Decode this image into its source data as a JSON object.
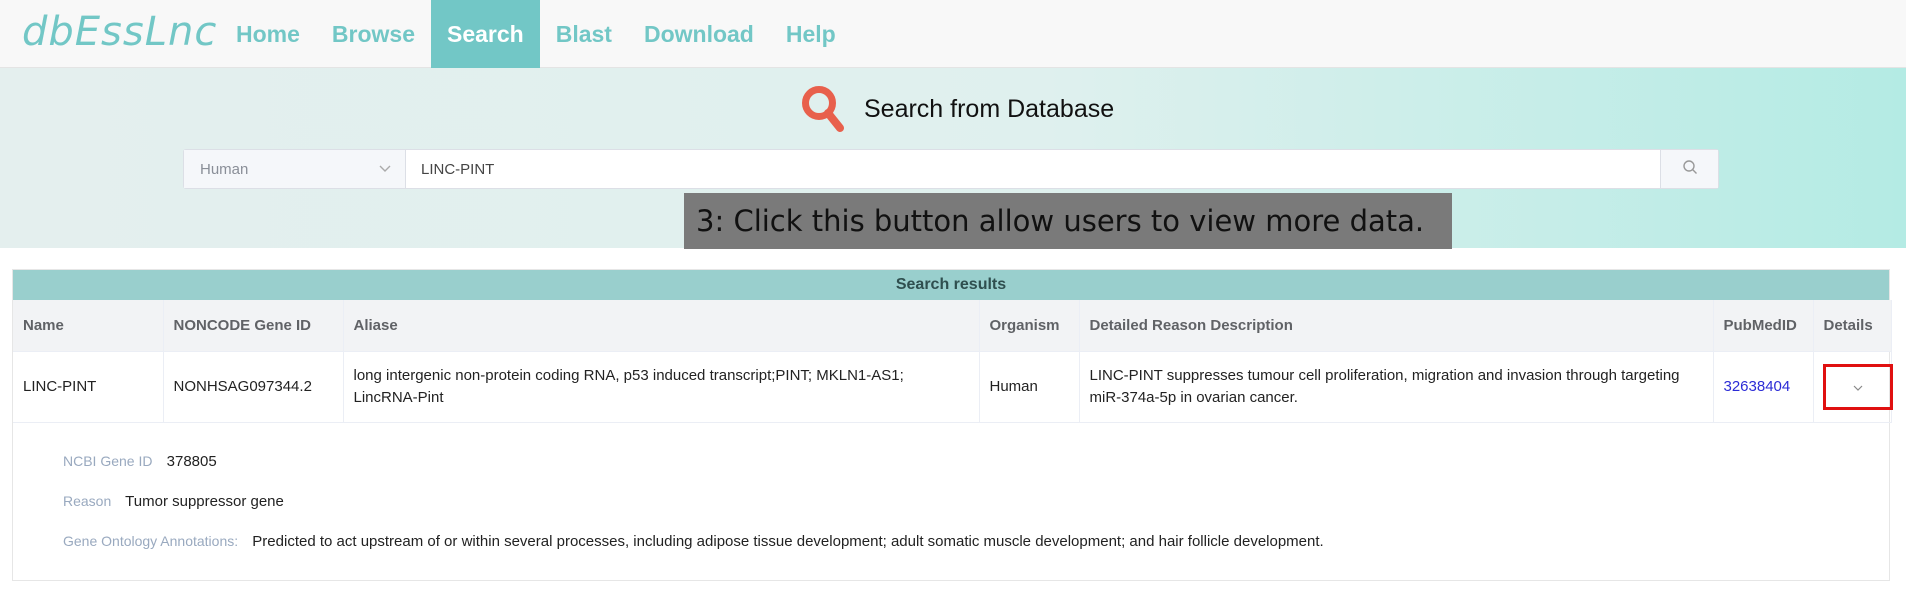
{
  "brand": {
    "logo": "dbEssLnc"
  },
  "nav": {
    "items": [
      {
        "label": "Home",
        "active": false
      },
      {
        "label": "Browse",
        "active": false
      },
      {
        "label": "Search",
        "active": true
      },
      {
        "label": "Blast",
        "active": false
      },
      {
        "label": "Download",
        "active": false
      },
      {
        "label": "Help",
        "active": false
      }
    ]
  },
  "hero": {
    "title": "Search from Database"
  },
  "search": {
    "species": "Human",
    "query": "LINC-PINT"
  },
  "annotation": {
    "text": "3: Click this button allow users to view more data."
  },
  "results": {
    "title": "Search results",
    "columns": [
      "Name",
      "NONCODE Gene ID",
      "Aliase",
      "Organism",
      "Detailed Reason Description",
      "PubMedID",
      "Details"
    ],
    "row": {
      "name": "LINC-PINT",
      "noncode_id": "NONHSAG097344.2",
      "aliase": "long intergenic non-protein coding RNA, p53 induced transcript;PINT; MKLN1-AS1; LincRNA-Pint",
      "organism": "Human",
      "description": "LINC-PINT suppresses tumour cell proliferation, migration and invasion through targeting miR-374a-5p in ovarian cancer.",
      "pubmed": "32638404"
    },
    "details": {
      "ncbi_label": "NCBI Gene ID",
      "ncbi_value": "378805",
      "reason_label": "Reason",
      "reason_value": "Tumor suppressor gene",
      "go_label": "Gene Ontology Annotations:",
      "go_value": "Predicted to act upstream of or within several processes, including adipose tissue development; adult somatic muscle development; and hair follicle development."
    }
  },
  "colors": {
    "accent": "#72c7c6",
    "highlight_border": "#e01010",
    "link": "#2b2bd6"
  }
}
